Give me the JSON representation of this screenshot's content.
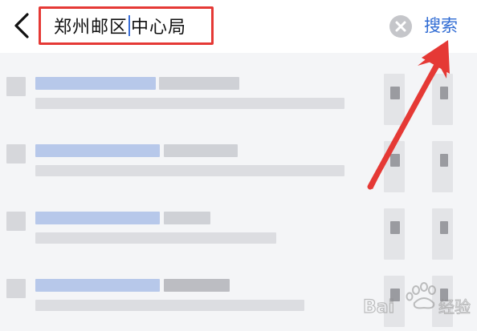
{
  "header": {
    "query_text": "郑州邮区中心局",
    "query_before_caret": "郑州邮区",
    "query_after_caret": "中心局",
    "search_label": "搜索"
  },
  "icons": {
    "back": "chevron-left-icon",
    "clear": "close-circle-icon"
  },
  "results": {
    "count_visible": 4,
    "content": "pixelated"
  },
  "watermark": {
    "text": "Bai经验"
  },
  "colors": {
    "accent": "#2f6bd3",
    "highlight_box": "#e53935",
    "arrow": "#e53935"
  }
}
